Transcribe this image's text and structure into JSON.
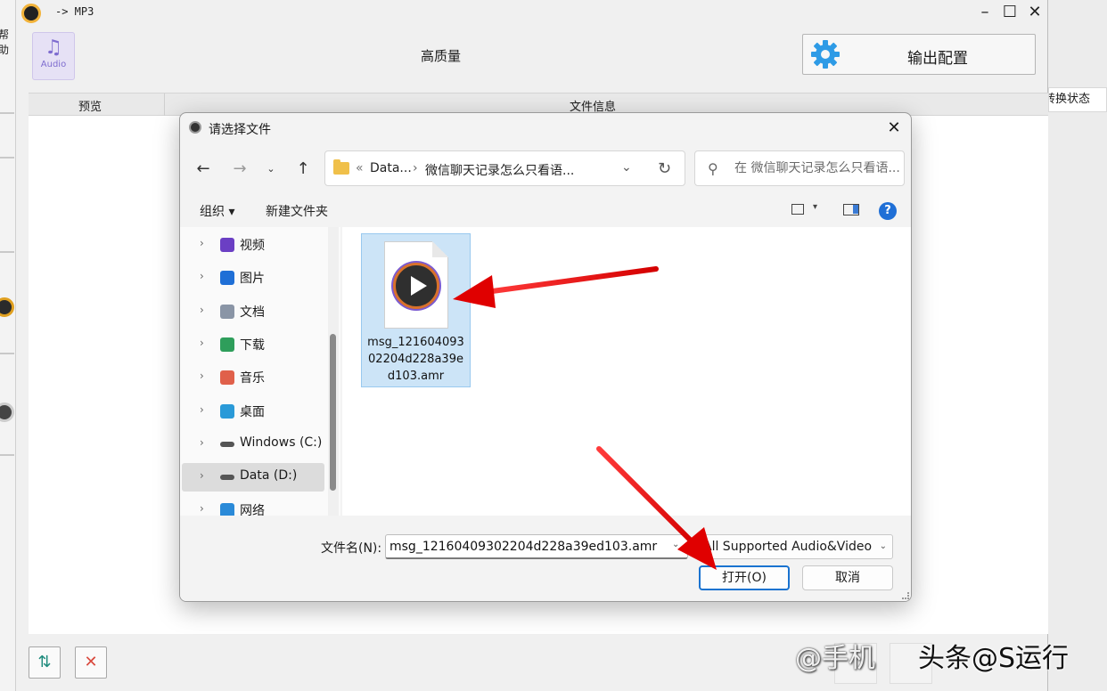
{
  "app": {
    "title": "-> MP3",
    "side_label": "帮助",
    "quality": "高质量",
    "config_button": "输出配置",
    "audio_tile": "Audio",
    "columns": {
      "preview": "预览",
      "file_info": "文件信息",
      "status": "转换状态"
    }
  },
  "dialog": {
    "title": "请选择文件",
    "address": {
      "root": "Data...",
      "folder": "微信聊天记录怎么只看语..."
    },
    "search_placeholder": "在 微信聊天记录怎么只看语...",
    "commands": {
      "organize": "组织 ▾",
      "new_folder": "新建文件夹"
    },
    "nav_items": [
      {
        "label": "视频",
        "icon": "video-icon"
      },
      {
        "label": "图片",
        "icon": "pictures-icon"
      },
      {
        "label": "文档",
        "icon": "documents-icon"
      },
      {
        "label": "下载",
        "icon": "download-icon"
      },
      {
        "label": "音乐",
        "icon": "music-icon"
      },
      {
        "label": "桌面",
        "icon": "desktop-icon"
      },
      {
        "label": "Windows (C:)",
        "icon": "drive-icon"
      },
      {
        "label": "Data (D:)",
        "icon": "drive-icon",
        "selected": true
      },
      {
        "label": "网络",
        "icon": "network-icon"
      }
    ],
    "file": {
      "name": "msg_12160409302204d228a39ed103.amr"
    },
    "filename_label": "文件名(N):",
    "filename_value": "msg_12160409302204d228a39ed103.amr",
    "file_type": "All Supported Audio&Video",
    "open_button": "打开(O)",
    "cancel_button": "取消"
  },
  "watermark": "头条@S运行",
  "watermark_faint": "@手机"
}
